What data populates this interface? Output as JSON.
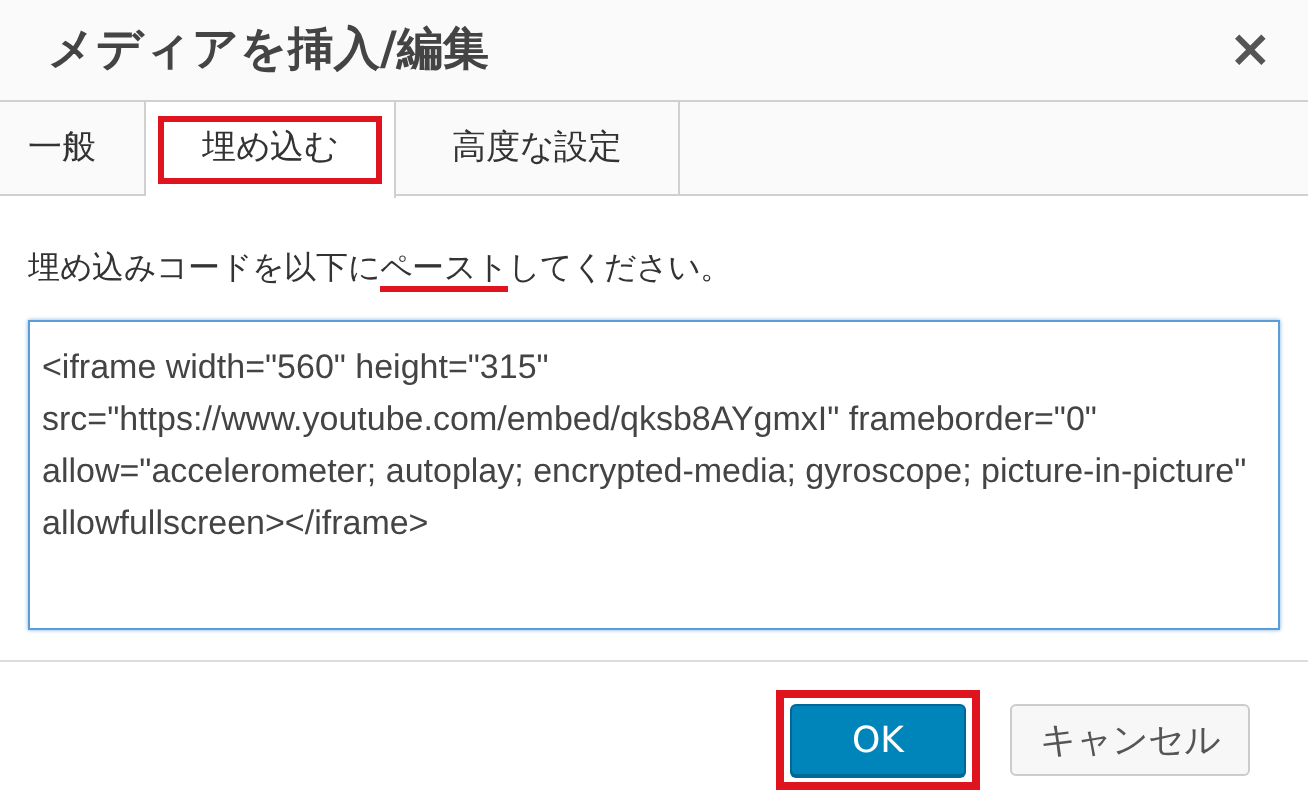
{
  "dialog": {
    "title": "メディアを挿入/編集",
    "close": "×"
  },
  "tabs": [
    {
      "label": "一般",
      "selected": false,
      "highlighted": false
    },
    {
      "label": "埋め込む",
      "selected": true,
      "highlighted": true
    },
    {
      "label": "高度な設定",
      "selected": false,
      "highlighted": false
    }
  ],
  "instruction": {
    "text_before": "埋め込みコードを以下に",
    "underlined": "ペースト",
    "text_after": "してください。"
  },
  "embed_code": {
    "value": "<iframe width=\"560\" height=\"315\" src=\"https://www.youtube.com/embed/qksb8AYgmxI\" frameborder=\"0\" allow=\"accelerometer; autoplay; encrypted-media; gyroscope; picture-in-picture\" allowfullscreen></iframe>"
  },
  "buttons": [
    {
      "label": "OK",
      "kind": "primary",
      "highlighted": true
    },
    {
      "label": "キャンセル",
      "kind": "secondary",
      "highlighted": false
    }
  ]
}
